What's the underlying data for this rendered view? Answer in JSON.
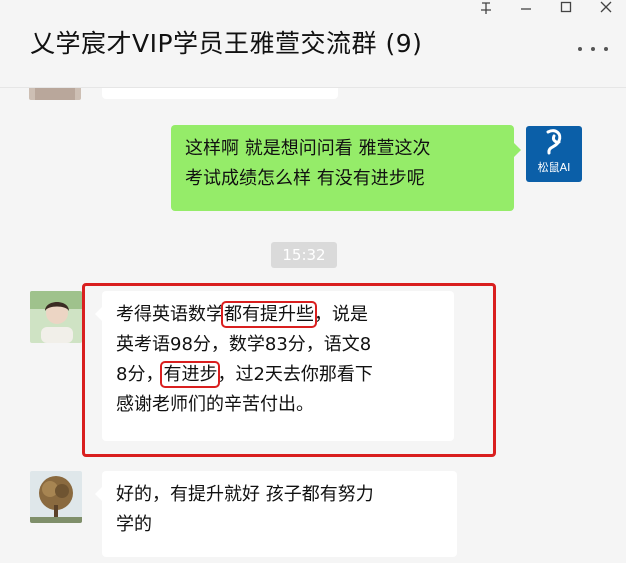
{
  "window": {
    "title": "乂学宸才VIP学员王雅萱交流群 (9)"
  },
  "messages": {
    "outgoing": {
      "lines": [
        "这样啊 就是想问问看 雅萱这次",
        "考试成绩怎么样 有没有进步呢"
      ],
      "avatar_label": "松鼠AI"
    },
    "timestamp": "15:32",
    "incoming1": {
      "l1a": "考得英语数学",
      "l1b": "都有提升些",
      "l1c": "，说是",
      "l2": "英考语98分，数学83分，语文8",
      "l3a": "8分，",
      "l3b": "有进步",
      "l3c": "，过2天去你那看下",
      "l4": "感谢老师们的辛苦付出。"
    },
    "incoming2": {
      "lines": [
        "好的，有提升就好 孩子都有努力",
        "学的"
      ]
    }
  },
  "colors": {
    "outgoing_bubble": "#95ec69",
    "annotation_red": "#d91f1f",
    "ai_avatar_bg": "#0b5fa8"
  }
}
